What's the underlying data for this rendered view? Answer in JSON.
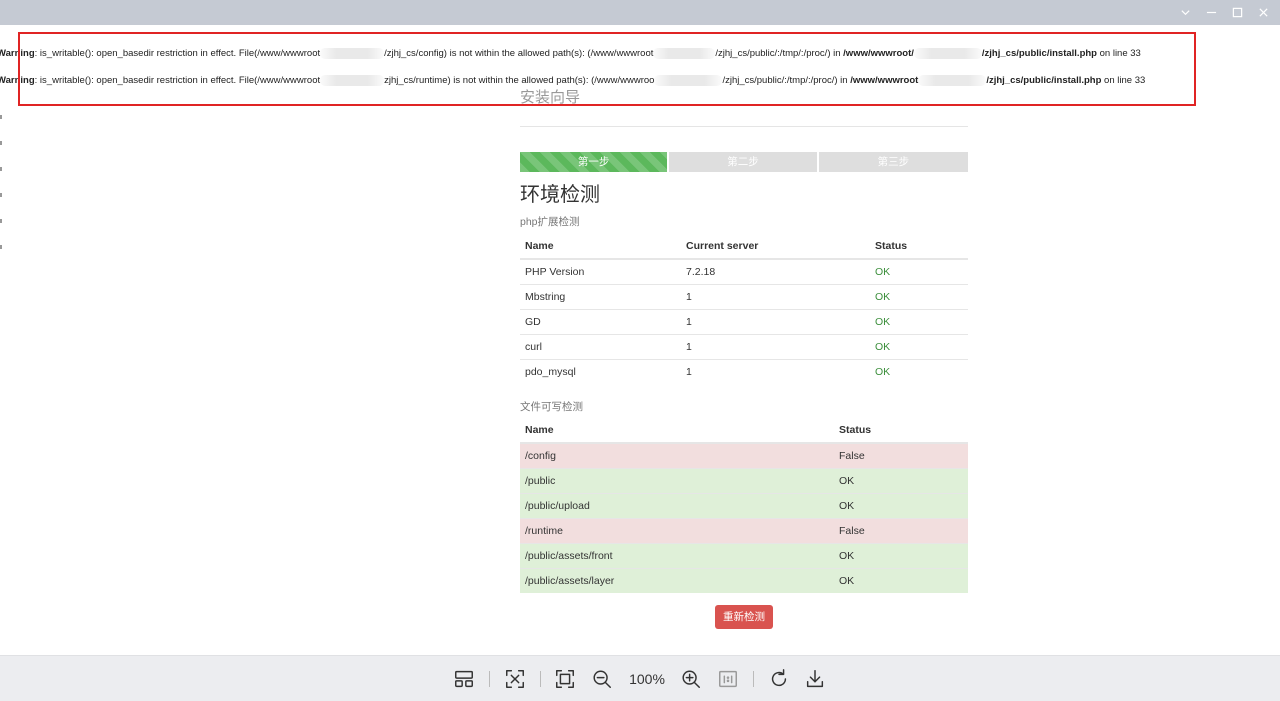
{
  "window": {
    "controls": [
      "chevron-down-icon",
      "minimize-icon",
      "maximize-icon",
      "close-icon"
    ]
  },
  "warnings": [
    {
      "prefix": "Warning",
      "text_a": ": is_writable(): open_basedir restriction in effect. File(/www/wwwroot",
      "text_b": "/zjhj_cs/config) is not within the allowed path(s): (/www/wwwroot",
      "text_c": "/zjhj_cs/public/:/tmp/:/proc/) in ",
      "path_a": "/www/wwwroot/",
      "path_b": "/zjhj_cs/public/install.php",
      "suffix": " on line ",
      "line": "33"
    },
    {
      "prefix": "Warning",
      "text_a": ": is_writable(): open_basedir restriction in effect. File(/www/wwwroot",
      "text_b": "zjhj_cs/runtime) is not within the allowed path(s): (/www/wwwroo",
      "text_c": "/zjhj_cs/public/:/tmp/:/proc/) in ",
      "path_a": "/www/wwwroot",
      "path_b": "/zjhj_cs/public/install.php",
      "suffix": " on line ",
      "line": "33"
    }
  ],
  "wizard": {
    "title": "安装向导",
    "steps": [
      "第一步",
      "第二步",
      "第三步"
    ],
    "heading": "环境检测",
    "php_section": "php扩展检测",
    "php_headers": [
      "Name",
      "Current server",
      "Status"
    ],
    "php_rows": [
      {
        "name": "PHP Version",
        "value": "7.2.18",
        "status": "OK"
      },
      {
        "name": "Mbstring",
        "value": "1",
        "status": "OK"
      },
      {
        "name": "GD",
        "value": "1",
        "status": "OK"
      },
      {
        "name": "curl",
        "value": "1",
        "status": "OK"
      },
      {
        "name": "pdo_mysql",
        "value": "1",
        "status": "OK"
      }
    ],
    "file_section": "文件可写检测",
    "file_headers": [
      "Name",
      "Status"
    ],
    "file_rows": [
      {
        "name": "/config",
        "status": "False"
      },
      {
        "name": "/public",
        "status": "OK"
      },
      {
        "name": "/public/upload",
        "status": "OK"
      },
      {
        "name": "/runtime",
        "status": "False"
      },
      {
        "name": "/public/assets/front",
        "status": "OK"
      },
      {
        "name": "/public/assets/layer",
        "status": "OK"
      }
    ],
    "recheck_label": "重新检测"
  },
  "colors": {
    "warning_box": "#e02424",
    "step_active": "#5cb85c",
    "step_inactive": "#dedede",
    "row_false": "#f2dede",
    "row_ok": "#dff0d8",
    "ok_text": "#3c8f3c",
    "recheck_button": "#d9534f"
  },
  "toolbar": {
    "zoom": "100%",
    "icons": [
      "layout-icon",
      "fit-window-icon",
      "fullscreen-icon",
      "zoom-out-icon",
      "zoom-in-icon",
      "actual-size-icon",
      "rotate-icon",
      "download-icon"
    ]
  }
}
